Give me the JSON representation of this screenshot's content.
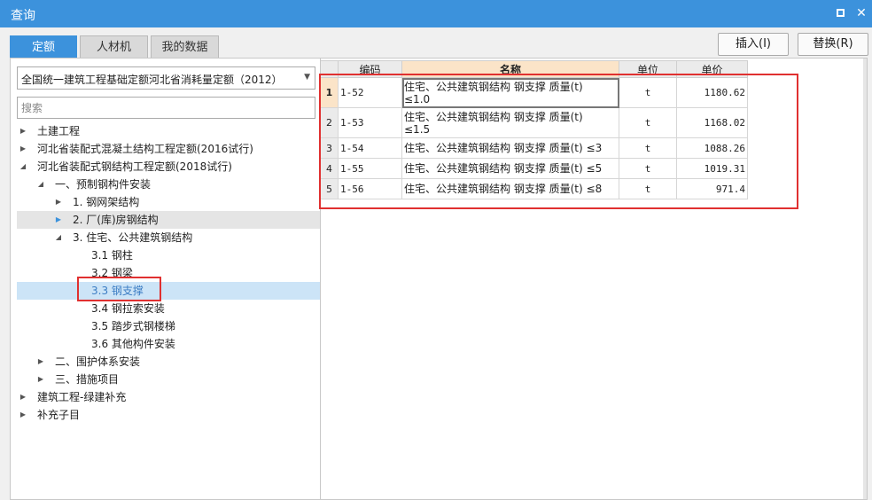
{
  "window": {
    "title": "查询",
    "maximize_icon": "maximize-icon",
    "close_icon": "close-icon",
    "close_glyph": "✕"
  },
  "tabs": [
    {
      "label": "定额",
      "active": true
    },
    {
      "label": "人材机",
      "active": false
    },
    {
      "label": "我的数据",
      "active": false
    }
  ],
  "actions": {
    "insert_label": "插入(I)",
    "replace_label": "替换(R)"
  },
  "left": {
    "library_value": "全国统一建筑工程基础定额河北省消耗量定额（2012）",
    "search_placeholder": "搜索",
    "tree": [
      {
        "label": "土建工程",
        "twisty": "▶"
      },
      {
        "label": "河北省装配式混凝土结构工程定额(2016试行)",
        "twisty": "▶"
      },
      {
        "label": "河北省装配式钢结构工程定额(2018试行)",
        "twisty": "◢"
      },
      {
        "label": "一、预制钢构件安装",
        "twisty": "◢"
      },
      {
        "label": "1. 钢网架结构",
        "twisty": "▶"
      },
      {
        "label": "2. 厂(库)房钢结构",
        "twisty": "▶",
        "state": "hover"
      },
      {
        "label": "3. 住宅、公共建筑钢结构",
        "twisty": "◢"
      },
      {
        "label": "3.1 钢柱",
        "twisty": ""
      },
      {
        "label": "3.2 钢梁",
        "twisty": ""
      },
      {
        "label": "3.3 钢支撑",
        "twisty": "",
        "state": "selected"
      },
      {
        "label": "3.4 钢拉索安装",
        "twisty": ""
      },
      {
        "label": "3.5 踏步式钢楼梯",
        "twisty": ""
      },
      {
        "label": "3.6 其他构件安装",
        "twisty": ""
      },
      {
        "label": "二、围护体系安装",
        "twisty": "▶"
      },
      {
        "label": "三、措施项目",
        "twisty": "▶"
      },
      {
        "label": "建筑工程-绿建补充",
        "twisty": "▶"
      },
      {
        "label": "补充子目",
        "twisty": "▶"
      }
    ]
  },
  "table": {
    "headers": {
      "code": "编码",
      "name": "名称",
      "unit": "单位",
      "price": "单价"
    },
    "rows": [
      {
        "rn": "1",
        "code": "1-52",
        "name_l1": "住宅、公共建筑钢结构 钢支撑 质量(t)",
        "name_l2": "≤1.0",
        "unit": "t",
        "price": "1180.62"
      },
      {
        "rn": "2",
        "code": "1-53",
        "name_l1": "住宅、公共建筑钢结构 钢支撑 质量(t)",
        "name_l2": "≤1.5",
        "unit": "t",
        "price": "1168.02"
      },
      {
        "rn": "3",
        "code": "1-54",
        "name_l1": "住宅、公共建筑钢结构 钢支撑 质量(t) ≤3",
        "name_l2": "",
        "unit": "t",
        "price": "1088.26"
      },
      {
        "rn": "4",
        "code": "1-55",
        "name_l1": "住宅、公共建筑钢结构 钢支撑 质量(t) ≤5",
        "name_l2": "",
        "unit": "t",
        "price": "1019.31"
      },
      {
        "rn": "5",
        "code": "1-56",
        "name_l1": "住宅、公共建筑钢结构 钢支撑 质量(t) ≤8",
        "name_l2": "",
        "unit": "t",
        "price": "971.4"
      }
    ]
  },
  "colors": {
    "title_bar": "#3c92dc",
    "active_tab": "#3c92dc",
    "selected_row": "#cce4f7",
    "highlight_box": "#e03030",
    "name_header": "#fbe4c8"
  }
}
